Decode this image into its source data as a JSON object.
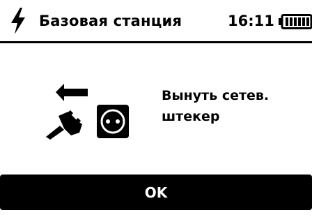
{
  "header": {
    "power_icon": "lightning-bolt-icon",
    "title": "Базовая станция",
    "time": "16:11",
    "battery_icon": "battery-icon"
  },
  "main": {
    "icon": "unplug-from-socket-icon",
    "message_line1": "Вынуть сетев.",
    "message_line2": "штекер"
  },
  "footer": {
    "ok_label": "OK"
  },
  "colors": {
    "background": "#ffffff",
    "foreground": "#000000",
    "button_bg": "#000000",
    "button_text": "#ffffff"
  }
}
